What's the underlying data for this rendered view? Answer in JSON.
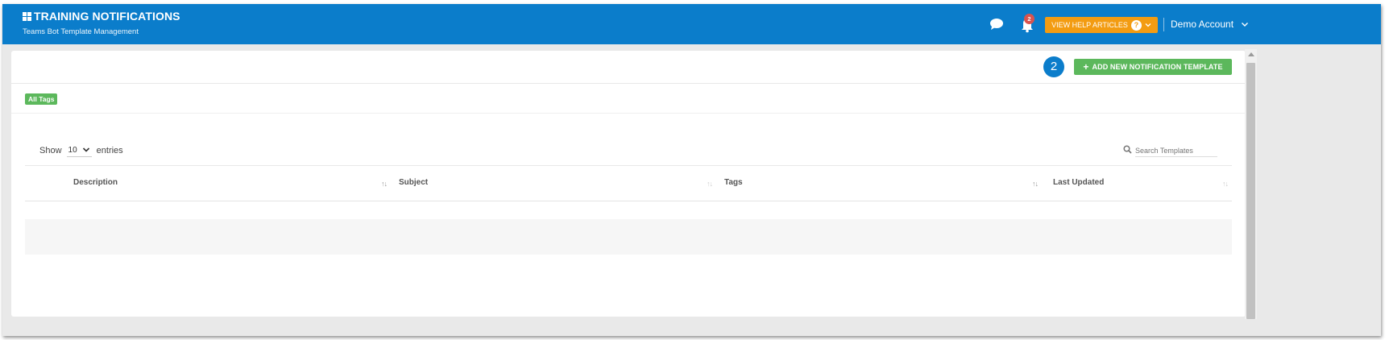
{
  "header": {
    "title": "TRAINING NOTIFICATIONS",
    "subtitle": "Teams Bot Template Management",
    "notification_count": "2",
    "help_button_label": "VIEW HELP ARTICLES",
    "help_button_icon": "?",
    "account_name": "Demo Account",
    "icons": [
      "grid-icon",
      "chat-icon",
      "bell-icon",
      "question-icon",
      "chevron-down-icon"
    ]
  },
  "toolbar": {
    "step_number": "2",
    "add_button_icon": "+",
    "add_button_label": "ADD NEW NOTIFICATION TEMPLATE"
  },
  "tags": {
    "items": [
      {
        "label": "All Tags"
      }
    ]
  },
  "table_controls": {
    "show_label": "Show",
    "entries_value": "10",
    "entries_label": "entries",
    "search_placeholder": "Search Templates"
  },
  "table": {
    "columns": [
      {
        "label": "Description",
        "sort": "↑↓"
      },
      {
        "label": "Subject",
        "sort": "↑↓"
      },
      {
        "label": "Tags",
        "sort": "↑↓"
      },
      {
        "label": "Last Updated",
        "sort": "↑↓"
      }
    ],
    "rows": []
  },
  "colors": {
    "header_blue": "#0b7dcb",
    "add_green": "#5cb85c",
    "help_orange": "#f39c12",
    "badge_red": "#d9534f"
  }
}
